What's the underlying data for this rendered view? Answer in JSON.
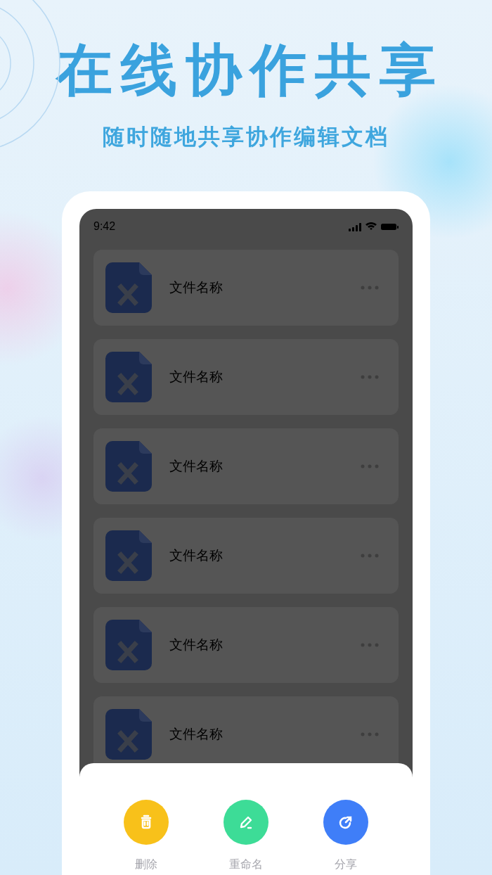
{
  "headline": "在线协作共享",
  "subheadline": "随时随地共享协作编辑文档",
  "status_bar": {
    "time": "9:42"
  },
  "files": [
    {
      "name": "文件名称"
    },
    {
      "name": "文件名称"
    },
    {
      "name": "文件名称"
    },
    {
      "name": "文件名称"
    },
    {
      "name": "文件名称"
    },
    {
      "name": "文件名称"
    }
  ],
  "actions": [
    {
      "kind": "delete",
      "label": "删除",
      "color": "#f8c11a"
    },
    {
      "kind": "rename",
      "label": "重命名",
      "color": "#3ddc97"
    },
    {
      "kind": "share",
      "label": "分享",
      "color": "#3f7ef8"
    }
  ]
}
